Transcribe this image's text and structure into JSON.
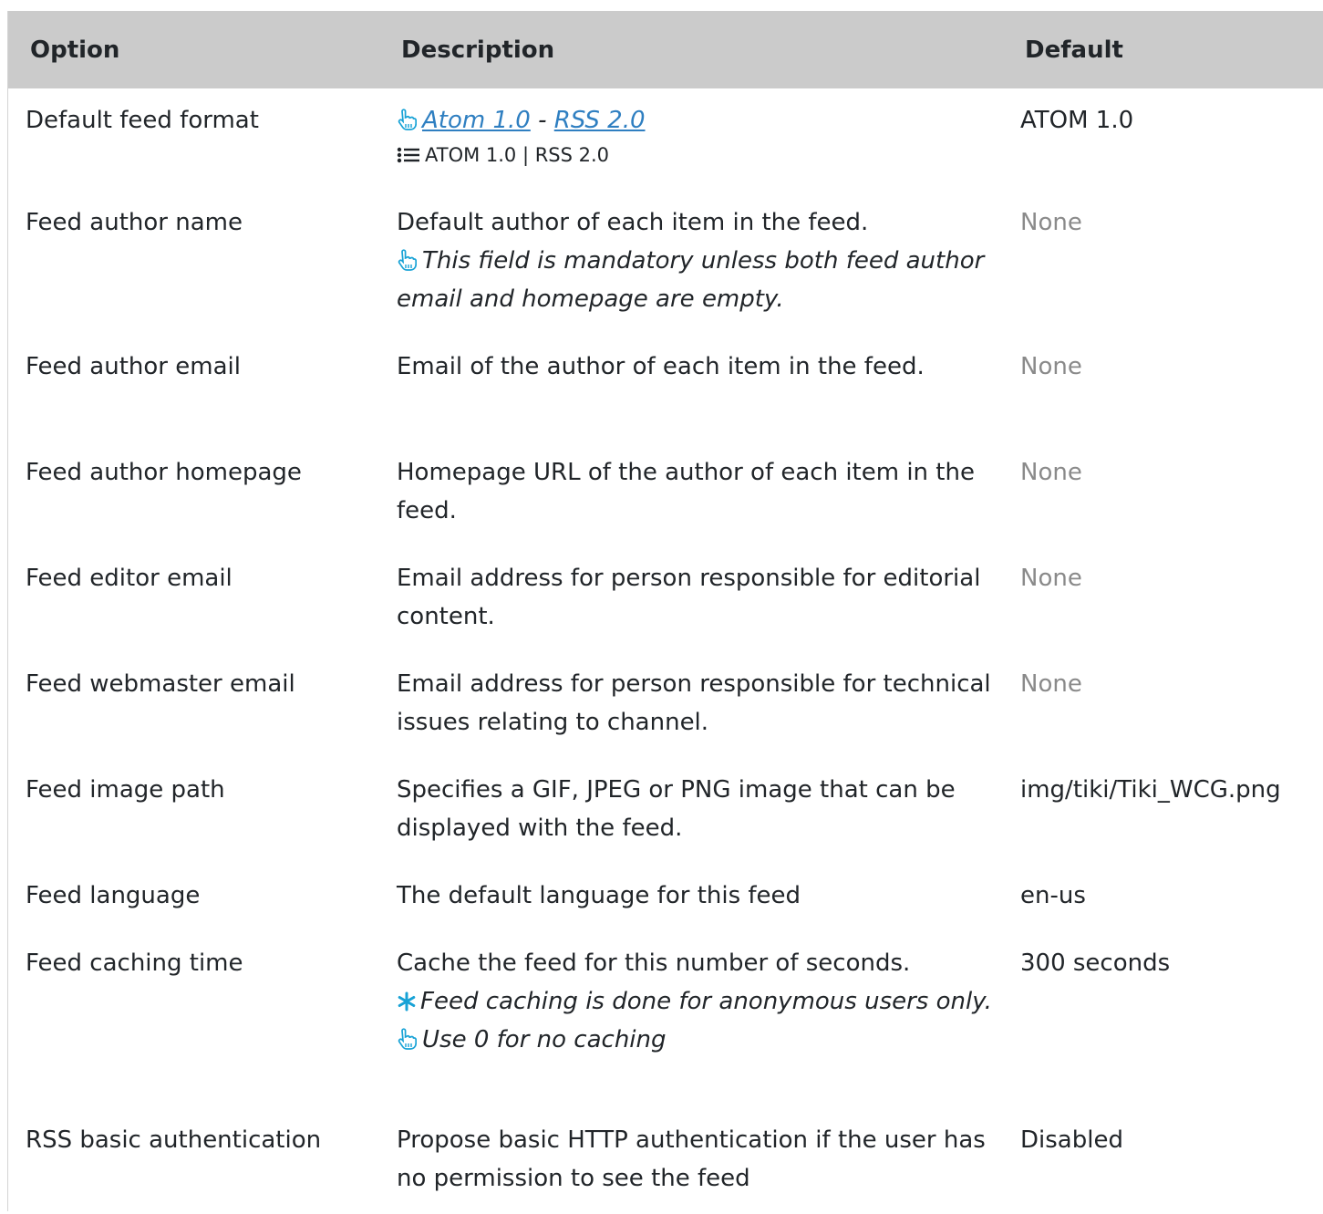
{
  "headers": {
    "option": "Option",
    "description": "Description",
    "default": "Default"
  },
  "rows": [
    {
      "option": "Default feed format",
      "links": [
        "Atom 1.0",
        "RSS 2.0"
      ],
      "link_separator": "-",
      "options_list": "ATOM 1.0 | RSS 2.0",
      "default": "ATOM 1.0"
    },
    {
      "option": "Feed author name",
      "description": "Default author of each item in the feed.",
      "note": "This field is mandatory unless both feed author email and homepage are empty.",
      "default": "None"
    },
    {
      "option": "Feed author email",
      "description": "Email of the author of each item in the feed.",
      "default": "None"
    },
    {
      "option": "Feed author homepage",
      "description": "Homepage URL of the author of each item in the feed.",
      "default": "None"
    },
    {
      "option": "Feed editor email",
      "description": "Email address for person responsible for editorial content.",
      "default": "None"
    },
    {
      "option": "Feed webmaster email",
      "description": "Email address for person responsible for technical issues relating to channel.",
      "default": "None"
    },
    {
      "option": "Feed image path",
      "description": "Specifies a GIF, JPEG or PNG image that can be displayed with the feed.",
      "default": "img/tiki/Tiki_WCG.png"
    },
    {
      "option": "Feed language",
      "description": "The default language for this feed",
      "default": "en-us"
    },
    {
      "option": "Feed caching time",
      "description": "Cache the feed for this number of seconds.",
      "warning": "Feed caching is done for anonymous users only.",
      "note": "Use 0 for no caching",
      "default": "300 seconds"
    },
    {
      "option": "RSS basic authentication",
      "description": "Propose basic HTTP authentication if the user has no permission to see the feed",
      "default": "Disabled"
    }
  ],
  "colors": {
    "header_bg": "#cbcbcb",
    "link": "#2f7fc1",
    "icon": "#17a2d6",
    "muted": "#8a8a8a"
  },
  "icons": {
    "hand": "hand-pointer-icon",
    "list": "list-icon",
    "asterisk": "asterisk-icon"
  }
}
